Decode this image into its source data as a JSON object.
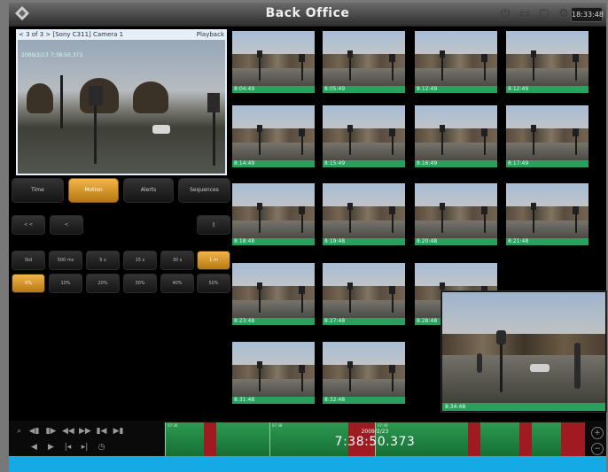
{
  "window": {
    "title": "Back Office",
    "clock": "18:33:48"
  },
  "titlebar_icons": [
    "power-icon",
    "display-icon",
    "folder-icon",
    "settings-icon"
  ],
  "live_view": {
    "header_left": "< 3 of 3 > [Sony C311] Camera 1",
    "header_right": "Playback",
    "subheader": "2009/2/23  7:38:50.373"
  },
  "mode_tabs": [
    {
      "label": "Time",
      "active": false
    },
    {
      "label": "Motion",
      "active": true
    },
    {
      "label": "Alerts",
      "active": false
    },
    {
      "label": "Sequences",
      "active": false
    }
  ],
  "nav_buttons": {
    "prev": "< <",
    "back": "<",
    "pause": "||"
  },
  "interval_buttons": [
    {
      "label": "Std",
      "active": false
    },
    {
      "label": "500 ms",
      "active": false
    },
    {
      "label": "5 s",
      "active": false
    },
    {
      "label": "15 s",
      "active": false
    },
    {
      "label": "30 s",
      "active": false
    },
    {
      "label": "1 m",
      "active": true
    }
  ],
  "sensitivity_buttons": [
    {
      "label": "0%",
      "active": true
    },
    {
      "label": "10%",
      "active": false
    },
    {
      "label": "20%",
      "active": false
    },
    {
      "label": "30%",
      "active": false
    },
    {
      "label": "40%",
      "active": false
    },
    {
      "label": "50%",
      "active": false
    }
  ],
  "thumbnails": [
    "8:04:49",
    "8:05:49",
    "8:12:49",
    "8:12:49",
    "8:14:49",
    "8:15:49",
    "8:16:49",
    "8:17:49",
    "8:18:48",
    "8:19:48",
    "8:20:48",
    "8:21:48",
    "8:23:48",
    "8:27:48",
    "8:28:48",
    "",
    "8:31:48",
    "8:32:48",
    "",
    ""
  ],
  "popup": {
    "time": "8:34:48"
  },
  "timeline": {
    "date": "2009/2/23",
    "time": "7:38:50.373",
    "labels": [
      "07:36",
      "07:38",
      "07:40"
    ]
  },
  "colors": {
    "accent": "#d89a2a",
    "timeline_green": "#2c9a50",
    "timeline_red": "#a01a22",
    "bottom_strip": "#15a9e6"
  }
}
